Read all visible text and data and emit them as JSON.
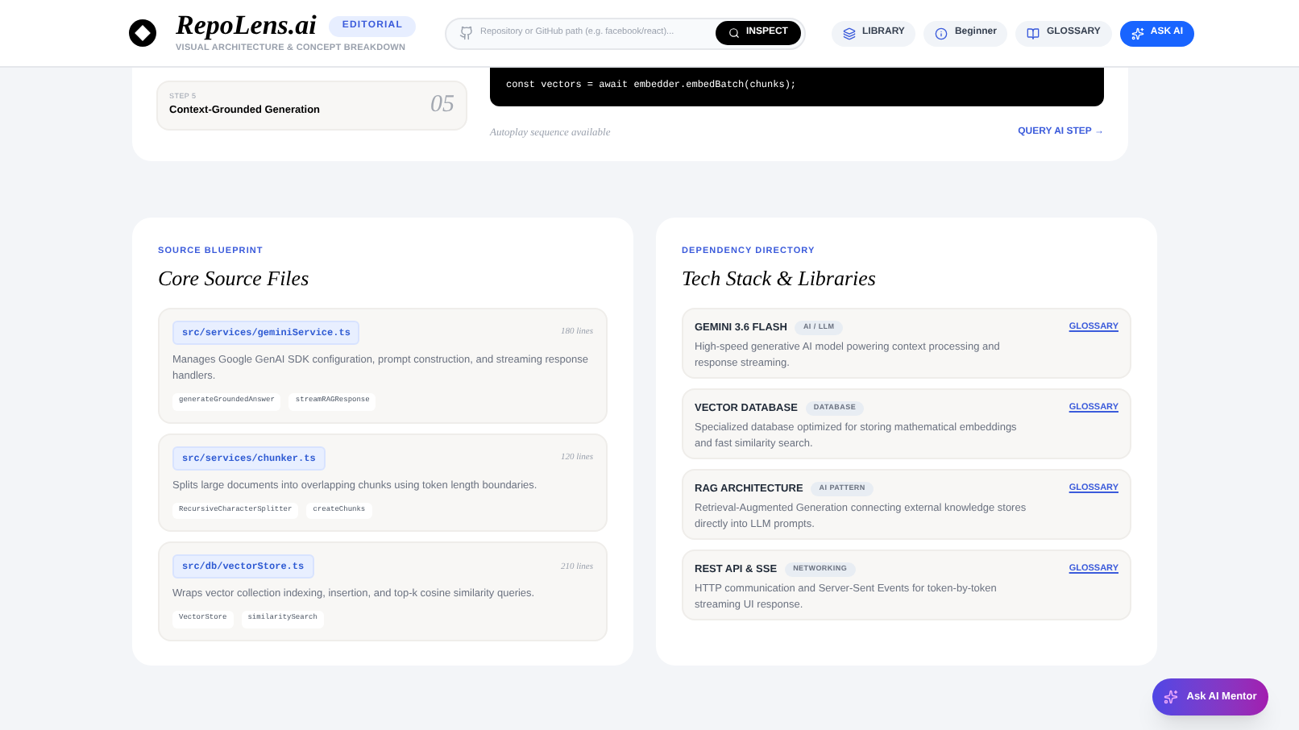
{
  "header": {
    "brand": "RepoLens.ai",
    "badge": "EDITORIAL",
    "tagline": "VISUAL ARCHITECTURE & CONCEPT BREAKDOWN",
    "search": {
      "placeholder": "Repository or GitHub path (e.g. facebook/react)..."
    },
    "inspect": "INSPECT",
    "nav": [
      {
        "kind": "library",
        "label": "LIBRARY",
        "primary": false
      },
      {
        "kind": "level",
        "label": "Beginner",
        "primary": false
      },
      {
        "kind": "glossary",
        "label": "GLOSSARY",
        "primary": false
      },
      {
        "kind": "ai",
        "label": "ASK AI",
        "primary": true
      }
    ]
  },
  "walkthrough": {
    "step": {
      "label": "STEP 5",
      "title": "Context-Grounded Generation",
      "number": "05"
    },
    "code": [
      "const vectors = await embedder.embedBatch(chunks);"
    ],
    "autoplay": "Autoplay sequence available",
    "query": "QUERY AI STEP →"
  },
  "files": {
    "eyebrow": "SOURCE BLUEPRINT",
    "title": "Core Source Files",
    "items": [
      {
        "path": "src/services/geminiService.ts",
        "lines": "180 lines",
        "description": "Manages Google GenAI SDK configuration, prompt construction, and streaming response handlers.",
        "symbols": [
          "generateGroundedAnswer",
          "streamRAGResponse"
        ]
      },
      {
        "path": "src/services/chunker.ts",
        "lines": "120 lines",
        "description": "Splits large documents into overlapping chunks using token length boundaries.",
        "symbols": [
          "RecursiveCharacterSplitter",
          "createChunks"
        ]
      },
      {
        "path": "src/db/vectorStore.ts",
        "lines": "210 lines",
        "description": "Wraps vector collection indexing, insertion, and top-k cosine similarity queries.",
        "symbols": [
          "VectorStore",
          "similaritySearch"
        ]
      }
    ]
  },
  "stack": {
    "eyebrow": "DEPENDENCY DIRECTORY",
    "title": "Tech Stack & Libraries",
    "items": [
      {
        "name": "GEMINI 3.6 FLASH",
        "tag": "AI / LLM",
        "link": "GLOSSARY",
        "description": "High-speed generative AI model powering context processing and response streaming."
      },
      {
        "name": "VECTOR DATABASE",
        "tag": "DATABASE",
        "link": "GLOSSARY",
        "description": "Specialized database optimized for storing mathematical embeddings and fast similarity search."
      },
      {
        "name": "RAG ARCHITECTURE",
        "tag": "AI PATTERN",
        "link": "GLOSSARY",
        "description": "Retrieval-Augmented Generation connecting external knowledge stores directly into LLM prompts."
      },
      {
        "name": "REST API & SSE",
        "tag": "NETWORKING",
        "link": "GLOSSARY",
        "description": "HTTP communication and Server-Sent Events for token-by-token streaming UI response."
      }
    ]
  },
  "mentor": "Ask AI Mentor"
}
